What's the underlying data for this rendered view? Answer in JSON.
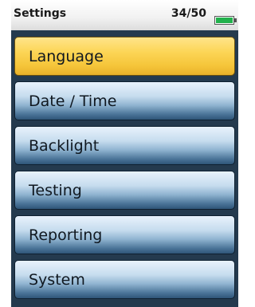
{
  "status_bar": {
    "title": "Settings",
    "count": "34/50",
    "battery_icon": "battery-icon",
    "battery_color": "#22b14c"
  },
  "menu": {
    "selected_color": "#f5c53a",
    "items": [
      {
        "label": "Language",
        "selected": true
      },
      {
        "label": "Date / Time",
        "selected": false
      },
      {
        "label": "Backlight",
        "selected": false
      },
      {
        "label": "Testing",
        "selected": false
      },
      {
        "label": "Reporting",
        "selected": false
      },
      {
        "label": "System",
        "selected": false
      }
    ]
  }
}
